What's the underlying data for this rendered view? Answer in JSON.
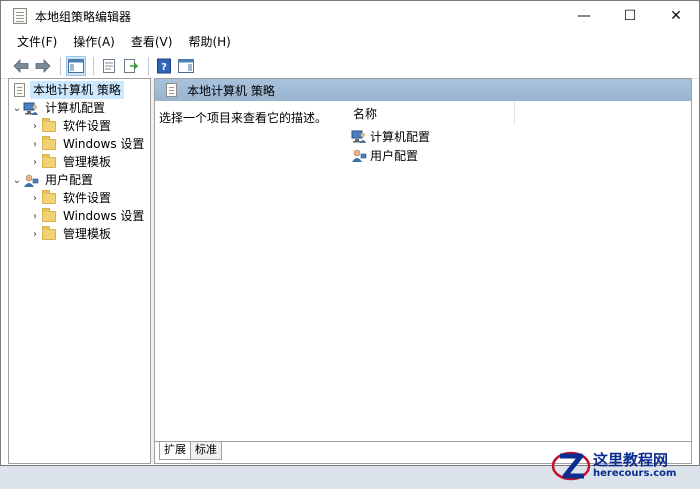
{
  "window": {
    "title": "本地组策略编辑器"
  },
  "controls": {
    "minimize": "—",
    "maximize": "☐",
    "close": "✕"
  },
  "menu": [
    {
      "label": "文件(F)"
    },
    {
      "label": "操作(A)"
    },
    {
      "label": "查看(V)"
    },
    {
      "label": "帮助(H)"
    }
  ],
  "tree": {
    "root": "本地计算机 策略",
    "computer": {
      "label": "计算机配置",
      "children": [
        "软件设置",
        "Windows 设置",
        "管理模板"
      ]
    },
    "user": {
      "label": "用户配置",
      "children": [
        "软件设置",
        "Windows 设置",
        "管理模板"
      ]
    }
  },
  "right": {
    "header": "本地计算机 策略",
    "description": "选择一个项目来查看它的描述。",
    "column_name": "名称",
    "items": [
      "计算机配置",
      "用户配置"
    ]
  },
  "tabs": [
    "扩展",
    "标准"
  ],
  "watermark": {
    "title": "这里教程网",
    "subtitle": "herecours.com"
  },
  "colors": {
    "header_bg": "#a9c2dc",
    "selection": "#cce8ff",
    "folder": "#f3d275",
    "watermark": "#0a2d8f"
  }
}
